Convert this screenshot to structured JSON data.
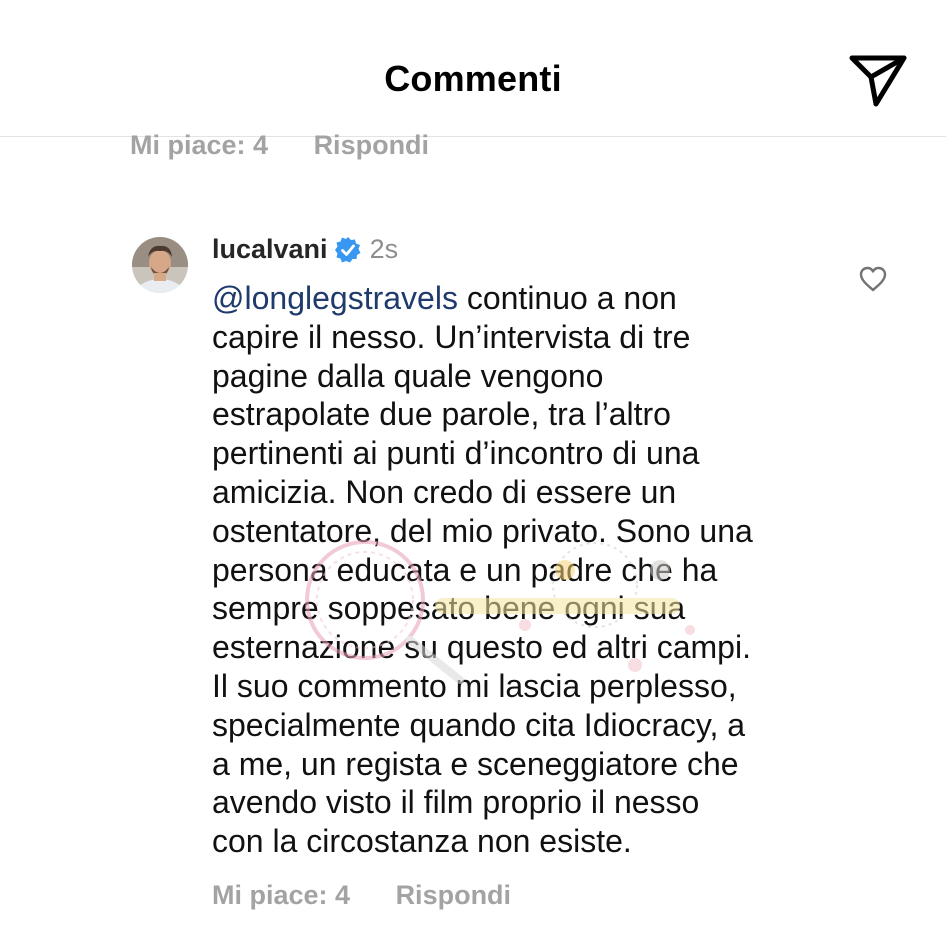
{
  "header": {
    "title": "Commenti",
    "share_icon": "paper-plane-icon"
  },
  "previous_comment": {
    "likes_label": "Mi piace: 4",
    "reply_label": "Rispondi"
  },
  "comment": {
    "username": "lucalvani",
    "verified_icon": "verified-badge-icon",
    "timestamp": "2s",
    "mention": "@longlegstravels",
    "lines": [
      " continuo a non",
      "capire il nesso. Un’intervista di tre",
      "pagine dalla quale vengono",
      "estrapolate due parole, tra l’altro",
      "pertinenti ai punti d’incontro di una",
      "amicizia. Non credo di essere un",
      "ostentatore, del mio privato. Sono una",
      "persona educata e un padre che ha",
      "sempre soppesato bene ogni sua",
      "esternazione su questo ed altri campi.",
      "Il suo commento mi lascia perplesso,",
      "specialmente quando cita Idiocracy, a",
      "a me, un regista e sceneggiatore che",
      "avendo visto il film proprio il nesso",
      "con la circostanza non esiste."
    ],
    "likes_label": "Mi piace: 4",
    "reply_label": "Rispondi",
    "like_icon": "heart-icon"
  },
  "colors": {
    "mention": "#1e3b6c",
    "verified": "#3897f0",
    "muted": "#a3a3a3"
  }
}
